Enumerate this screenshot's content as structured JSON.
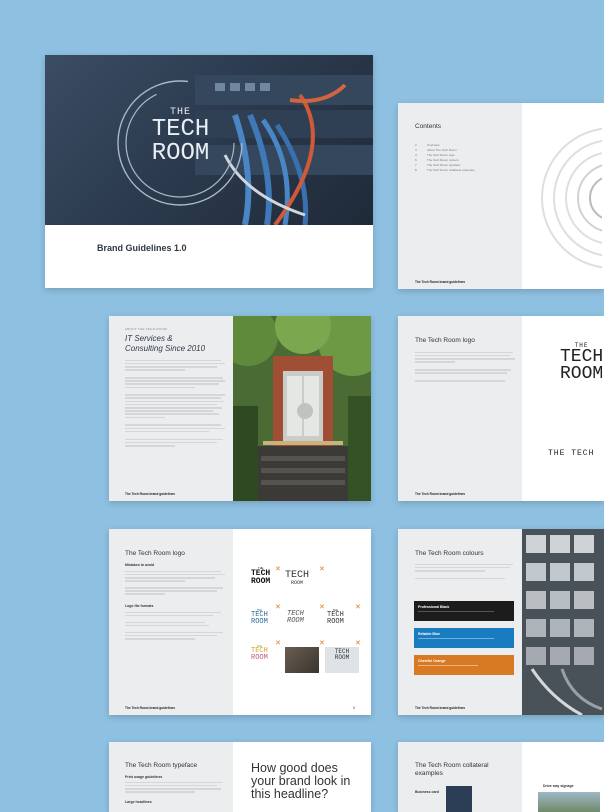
{
  "cover": {
    "logo_the": "THE",
    "logo_tech": "TECH",
    "logo_room": "ROOM",
    "title": "Brand Guidelines 1.0"
  },
  "contents": {
    "heading": "Contents",
    "items": [
      {
        "num": "2",
        "label": "Overview"
      },
      {
        "num": "3",
        "label": "About The Tech Room"
      },
      {
        "num": "4",
        "label": "The Tech Room logo"
      },
      {
        "num": "6",
        "label": "The Tech Room colours"
      },
      {
        "num": "7",
        "label": "The Tech Room typeface"
      },
      {
        "num": "8",
        "label": "The Tech Room collateral examples"
      }
    ],
    "footer": "The Tech Room brand guidelines"
  },
  "about": {
    "kicker": "ABOUT THE TECH ROOM",
    "heading_line1": "IT Services &",
    "heading_line2": "Consulting Since 2010",
    "footer": "The Tech Room brand guidelines"
  },
  "logo_page": {
    "heading": "The Tech Room logo",
    "logo_the": "THE",
    "logo_tech": "TECH",
    "logo_room": "ROOM",
    "wordmark": "THE TECH",
    "footer": "The Tech Room brand guidelines"
  },
  "logo_misuse": {
    "heading": "The Tech Room logo",
    "sub1": "Mistakes to avoid",
    "sub2": "Logo file formats",
    "footer": "The Tech Room brand guidelines",
    "page_num": "5",
    "sample_the": "THE",
    "sample_tech": "TECH",
    "sample_room": "ROOM",
    "x_mark": "✕"
  },
  "colours": {
    "heading": "The Tech Room colours",
    "swatches": [
      {
        "name": "Professional Black",
        "color": "#1c1c1c"
      },
      {
        "name": "Reliable Blue",
        "color": "#1a7cc0"
      },
      {
        "name": "Cheerful Orange",
        "color": "#d87a24"
      }
    ],
    "footer": "The Tech Room brand guidelines"
  },
  "typeface": {
    "heading": "The Tech Room typeface",
    "sub1": "Print usage guidelines",
    "sub2": "Large headlines",
    "sample_line1": "How good does",
    "sample_line2": "your brand look in",
    "sample_line3": "this headline?"
  },
  "collateral": {
    "heading_line1": "The Tech Room collateral",
    "heading_line2": "examples",
    "sub1": "Business card",
    "sub2": "Drive way signage"
  }
}
